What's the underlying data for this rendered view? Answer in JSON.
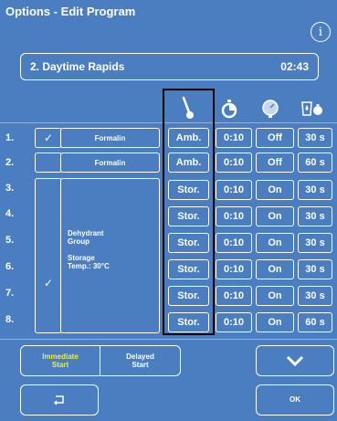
{
  "window": {
    "title": "Options - Edit Program",
    "info_icon_glyph": "i"
  },
  "program": {
    "name": "2. Daytime Rapids",
    "duration": "02:43"
  },
  "columns": {
    "temperature_icon": "thermometer-icon",
    "time_icon": "stopwatch-icon",
    "pressure_icon": "pressure-gauge-icon",
    "drip_icon": "drip-time-icon"
  },
  "rows": [
    {
      "num": "1.",
      "reagent": "Formalin",
      "temp": "Amb.",
      "time": "0:10",
      "pv": "Off",
      "drip": "30 s",
      "checked": true
    },
    {
      "num": "2.",
      "reagent": "Formalin",
      "temp": "Amb.",
      "time": "0:10",
      "pv": "Off",
      "drip": "60 s",
      "checked": false
    },
    {
      "num": "3.",
      "temp": "Stor.",
      "time": "0:10",
      "pv": "On",
      "drip": "30 s"
    },
    {
      "num": "4.",
      "temp": "Stor.",
      "time": "0:10",
      "pv": "On",
      "drip": "30 s"
    },
    {
      "num": "5.",
      "temp": "Stor.",
      "time": "0:10",
      "pv": "On",
      "drip": "30 s"
    },
    {
      "num": "6.",
      "temp": "Stor.",
      "time": "0:10",
      "pv": "On",
      "drip": "30 s"
    },
    {
      "num": "7.",
      "temp": "Stor.",
      "time": "0:10",
      "pv": "On",
      "drip": "30 s"
    },
    {
      "num": "8.",
      "temp": "Stor.",
      "time": "0:10",
      "pv": "On",
      "drip": "60 s"
    }
  ],
  "group": {
    "line1": "Dehydrant",
    "line2": "Group",
    "line3": "Storage",
    "line4": "Temp.: 30°C",
    "checked": true
  },
  "check_glyph": "✓",
  "buttons": {
    "immediate_line1": "Immediate",
    "immediate_line2": "Start",
    "delayed_line1": "Delayed",
    "delayed_line2": "Start",
    "ok": "OK",
    "scroll_down_icon": "chevron-down-icon",
    "back_icon": "return-arrow-icon"
  },
  "colors": {
    "background": "#4a7ec0",
    "highlight_text": "#f2ee3a",
    "border": "#ffffff",
    "selection_box": "#000000"
  }
}
